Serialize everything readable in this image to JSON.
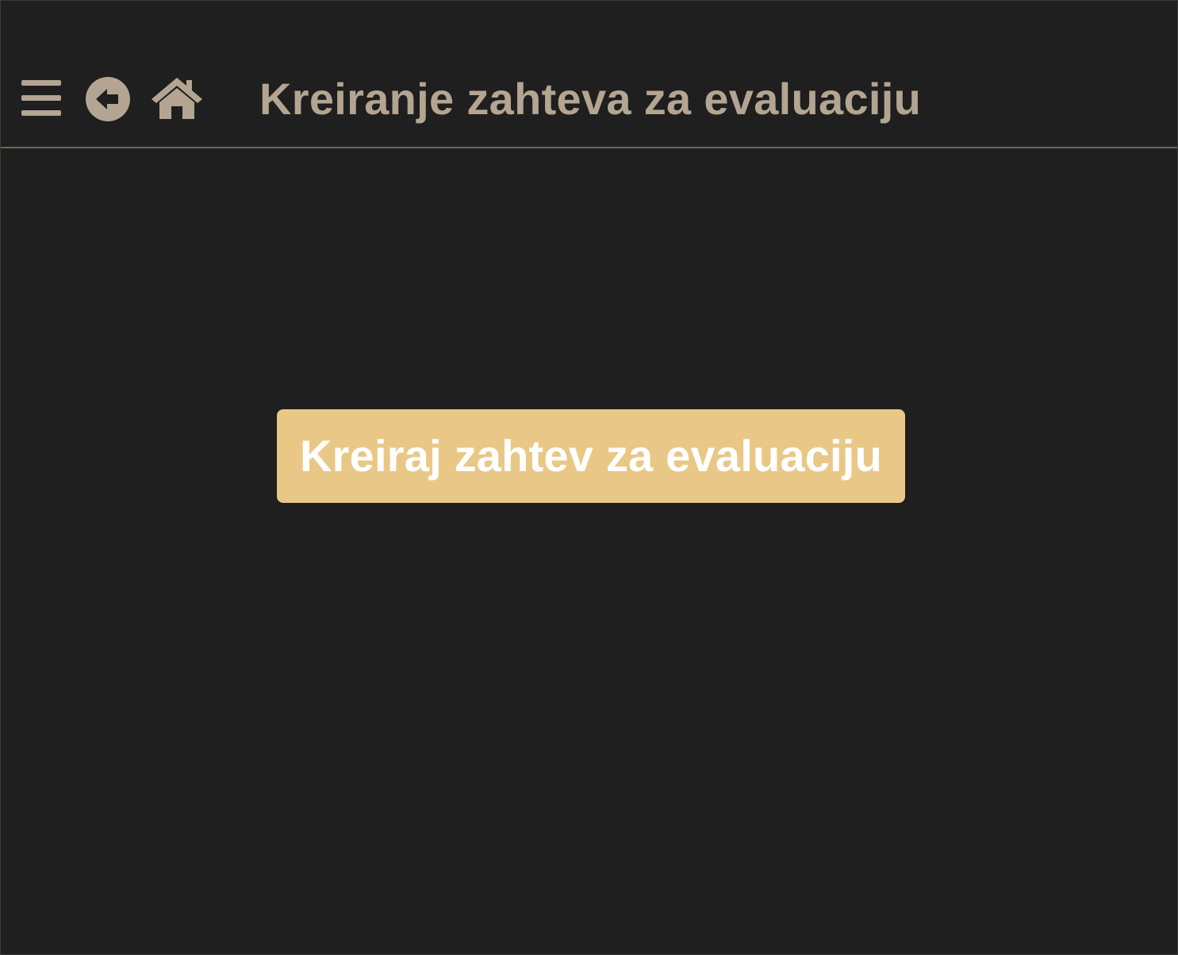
{
  "header": {
    "title": "Kreiranje zahteva za evaluaciju",
    "icons": {
      "menu": "menu-icon",
      "back": "back-arrow-icon",
      "home": "home-icon"
    }
  },
  "main": {
    "create_button_label": "Kreiraj zahtev za evaluaciju"
  },
  "colors": {
    "background": "#1f1f1f",
    "header_text": "#b3a591",
    "divider": "#6f655a",
    "accent": "#e9c887",
    "button_text": "#ffffff"
  }
}
